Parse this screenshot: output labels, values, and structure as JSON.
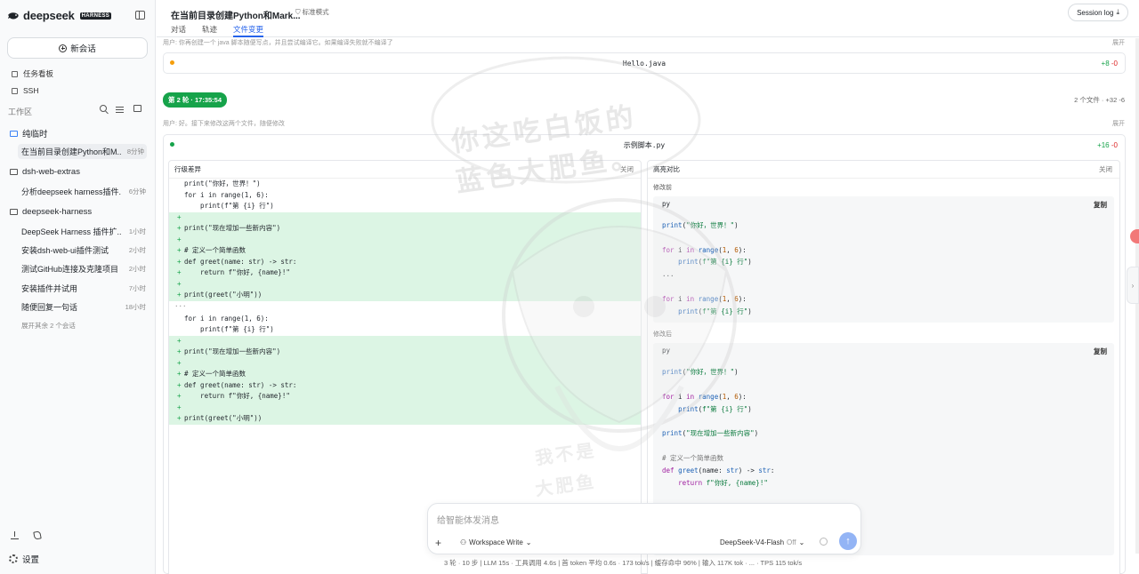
{
  "sidebar": {
    "logo": "deepseek",
    "badge": "HARNESS",
    "new_chat": "新会话",
    "nav": [
      "任务看板",
      "SSH"
    ],
    "workspace_label": "工作区",
    "groups": [
      {
        "name": "纯临时",
        "sessions": [
          {
            "title": "在当前目录创建Python和M...",
            "time": "8分钟",
            "active": true
          }
        ]
      },
      {
        "name": "dsh-web-extras",
        "sessions": [
          {
            "title": "分析deepseek harness插件...",
            "time": "6分钟"
          }
        ]
      },
      {
        "name": "deepseek-harness",
        "sessions": [
          {
            "title": "DeepSeek Harness 插件扩...",
            "time": "1小时"
          },
          {
            "title": "安装dsh-web-ui插件测试",
            "time": "2小时"
          },
          {
            "title": "测试GitHub连接及克隆项目",
            "time": "2小时"
          },
          {
            "title": "安装插件并试用",
            "time": "7小时"
          },
          {
            "title": "随便回复一句话",
            "time": "18小时"
          }
        ]
      }
    ],
    "expand_more": "展开其余 2 个会话",
    "settings": "设置"
  },
  "header": {
    "title": "在当前目录创建Python和Mark...",
    "mode": "标准模式",
    "tabs": [
      "对话",
      "轨迹",
      "文件变更"
    ],
    "active_tab": 2,
    "session_log": "Session log"
  },
  "main": {
    "round1": {
      "user_text": "用户:  你再创建一个 java 脚本随便写点，并且尝试编译它。如果编译失败就不编译了",
      "expand": "展开",
      "file": "Hello.java",
      "add": "+8",
      "del": "-0"
    },
    "round2": {
      "badge": "第 2 轮 · 17:35:54",
      "stats": "2 个文件 · +32 -6",
      "user_text": "用户:  好。接下来修改这两个文件，随便修改",
      "expand": "展开",
      "file": "示例脚本.py",
      "add": "+16",
      "del": "-0"
    },
    "diff_pane": {
      "title": "行级差异",
      "close": "关闭",
      "lines": [
        {
          "t": "ctx",
          "c": "print(\"你好，世界！\")"
        },
        {
          "t": "ctx",
          "c": "for i in range(1, 6):"
        },
        {
          "t": "ctx",
          "c": "    print(f\"第 {i} 行\")"
        },
        {
          "t": "add",
          "c": ""
        },
        {
          "t": "add",
          "c": "print(\"现在增加一些新内容\")"
        },
        {
          "t": "add",
          "c": ""
        },
        {
          "t": "add",
          "c": "# 定义一个简单函数"
        },
        {
          "t": "add",
          "c": "def greet(name: str) -> str:"
        },
        {
          "t": "add",
          "c": "    return f\"你好, {name}!\""
        },
        {
          "t": "add",
          "c": ""
        },
        {
          "t": "add",
          "c": "print(greet(\"小明\"))"
        },
        {
          "t": "sep",
          "c": "···"
        },
        {
          "t": "ctx",
          "c": "for i in range(1, 6):"
        },
        {
          "t": "ctx",
          "c": "    print(f\"第 {i} 行\")"
        },
        {
          "t": "add",
          "c": ""
        },
        {
          "t": "add",
          "c": "print(\"现在增加一些新内容\")"
        },
        {
          "t": "add",
          "c": ""
        },
        {
          "t": "add",
          "c": "# 定义一个简单函数"
        },
        {
          "t": "add",
          "c": "def greet(name: str) -> str:"
        },
        {
          "t": "add",
          "c": "    return f\"你好, {name}!\""
        },
        {
          "t": "add",
          "c": ""
        },
        {
          "t": "add",
          "c": "print(greet(\"小明\"))"
        }
      ]
    },
    "compare_pane": {
      "title": "高亮对比",
      "close": "关闭",
      "before_label": "修改前",
      "after_label": "修改后",
      "lang": "py",
      "copy": "复制"
    }
  },
  "composer": {
    "placeholder": "给智能体发消息",
    "mode": "Workspace Write",
    "model": "DeepSeek-V4-Flash",
    "model_state": "Off"
  },
  "statusbar": "3 轮 · 10 步   |   LLM 15s · 工具调用 4.6s   |   首 token 平均 0.6s · 173 tok/s   |   缓存命中 96%   |   输入 117K tok · ...   ·   TPS 115 tok/s",
  "watermark": {
    "line1": "你这吃白饭的",
    "line2": "蓝色大肥鱼。",
    "line3": "我不是",
    "line4": "大肥鱼"
  },
  "colors": {
    "accent": "#2563eb",
    "add_bg": "#dcf5e4",
    "badge_green": "#16a34a",
    "minus": "#dc2626"
  }
}
